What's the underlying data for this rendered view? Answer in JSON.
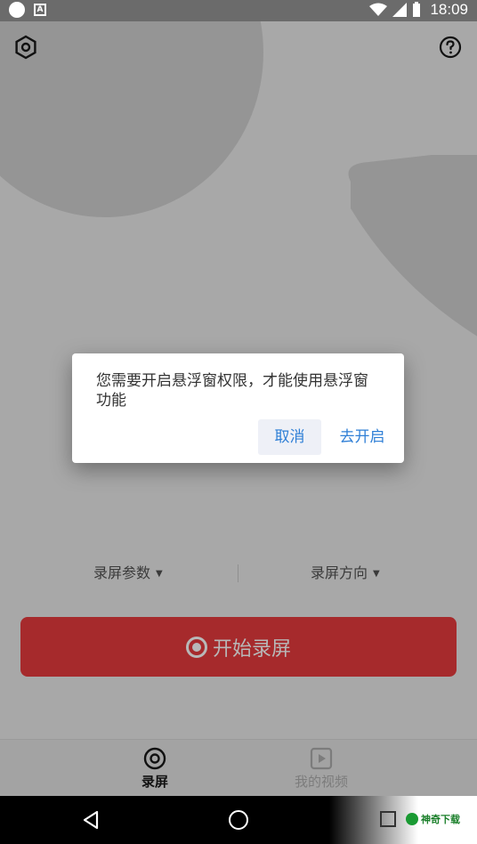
{
  "status_bar": {
    "time": "18:09"
  },
  "dialog": {
    "message": "您需要开启悬浮窗权限，才能使用悬浮窗功能",
    "cancel_label": "取消",
    "confirm_label": "去开启"
  },
  "options": {
    "params_label": "录屏参数",
    "direction_label": "录屏方向"
  },
  "record_button": {
    "label": "开始录屏"
  },
  "tabs": [
    {
      "label": "录屏",
      "icon": "record-tab-icon",
      "active": true
    },
    {
      "label": "我的视频",
      "icon": "video-tab-icon",
      "active": false
    }
  ],
  "watermark": {
    "text": "神奇下载"
  },
  "colors": {
    "accent_blue": "#2f7fd6",
    "record_red": "#a62a2c",
    "background": "#a8a8a8"
  }
}
